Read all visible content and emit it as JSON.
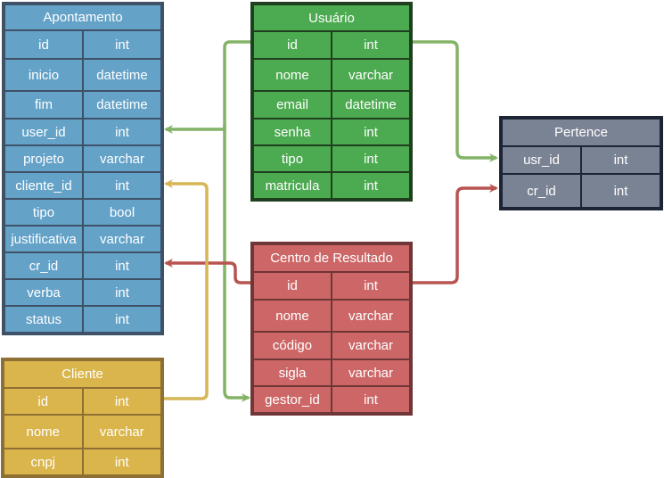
{
  "tables": {
    "apontamento": {
      "title": "Apontamento",
      "fill": "#64a2c8",
      "border": "#3f5166",
      "columns": [
        [
          "id",
          "int"
        ],
        [
          "inicio",
          "datetime"
        ],
        [
          "fim",
          "datetime"
        ],
        [
          "user_id",
          "int"
        ],
        [
          "projeto",
          "varchar"
        ],
        [
          "cliente_id",
          "int"
        ],
        [
          "tipo",
          "bool"
        ],
        [
          "justificativa",
          "varchar"
        ],
        [
          "cr_id",
          "int"
        ],
        [
          "verba",
          "int"
        ],
        [
          "status",
          "int"
        ]
      ]
    },
    "usuario": {
      "title": "Usuário",
      "fill": "#4caa50",
      "border": "#1f3f1f",
      "columns": [
        [
          "id",
          "int"
        ],
        [
          "nome",
          "varchar"
        ],
        [
          "email",
          "datetime"
        ],
        [
          "senha",
          "int"
        ],
        [
          "tipo",
          "int"
        ],
        [
          "matricula",
          "int"
        ]
      ]
    },
    "pertence": {
      "title": "Pertence",
      "fill": "#7a8394",
      "border": "#1c2436",
      "columns": [
        [
          "usr_id",
          "int"
        ],
        [
          "cr_id",
          "int"
        ]
      ]
    },
    "centro_resultado": {
      "title": "Centro de Resultado",
      "fill": "#cd6767",
      "border": "#6e3636",
      "columns": [
        [
          "id",
          "int"
        ],
        [
          "nome",
          "varchar"
        ],
        [
          "código",
          "varchar"
        ],
        [
          "sigla",
          "varchar"
        ],
        [
          "gestor_id",
          "int"
        ]
      ]
    },
    "cliente": {
      "title": "Cliente",
      "fill": "#dab54c",
      "border": "#8e6f34",
      "columns": [
        [
          "id",
          "int"
        ],
        [
          "nome",
          "varchar"
        ],
        [
          "cnpj",
          "int"
        ]
      ]
    }
  },
  "relations": [
    {
      "from": "usuario.id",
      "to": "apontamento.user_id",
      "color": "#82b366"
    },
    {
      "from": "usuario.id",
      "to": "centro_resultado.gestor_id",
      "color": "#82b366"
    },
    {
      "from": "usuario.id",
      "to": "pertence.usr_id",
      "color": "#82b366"
    },
    {
      "from": "centro_resultado.id",
      "to": "apontamento.cr_id",
      "color": "#b85450"
    },
    {
      "from": "centro_resultado.id",
      "to": "pertence.cr_id",
      "color": "#b85450"
    },
    {
      "from": "cliente.id",
      "to": "apontamento.cliente_id",
      "color": "#d6b656"
    }
  ]
}
